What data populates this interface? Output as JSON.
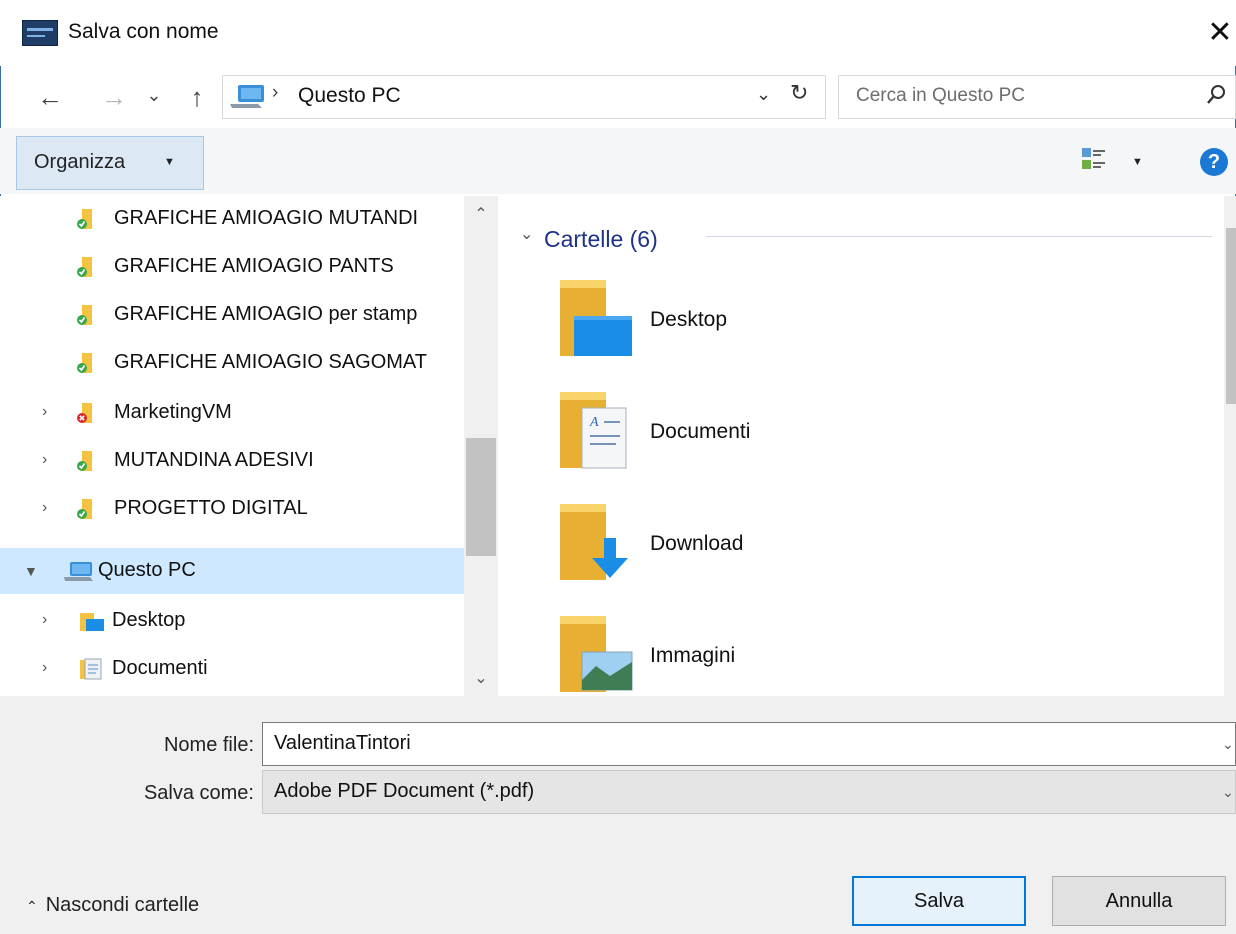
{
  "window": {
    "title": "Salva con nome",
    "close_symbol": "✕"
  },
  "nav": {
    "back_symbol": "←",
    "forward_symbol": "→",
    "recent_symbol": "⌄",
    "up_symbol": "↑",
    "separator": "›",
    "address_text": "Questo PC",
    "dropdown_symbol": "⌄",
    "refresh_symbol": "↻",
    "search_placeholder": "Cerca in Questo PC"
  },
  "toolbar": {
    "organize_label": "Organizza",
    "help_symbol": "?"
  },
  "tree": [
    {
      "label": "GRAFICHE AMIOAGIO MUTANDI",
      "icon": "folder-synced-icon",
      "expandable": false
    },
    {
      "label": "GRAFICHE AMIOAGIO PANTS",
      "icon": "folder-synced-icon",
      "expandable": false
    },
    {
      "label": "GRAFICHE AMIOAGIO per stamp",
      "icon": "folder-synced-icon",
      "expandable": false
    },
    {
      "label": "GRAFICHE AMIOAGIO SAGOMAT",
      "icon": "folder-synced-icon",
      "expandable": false
    },
    {
      "label": "MarketingVM",
      "icon": "folder-error-icon",
      "expandable": true
    },
    {
      "label": "MUTANDINA ADESIVI",
      "icon": "folder-synced-icon",
      "expandable": true
    },
    {
      "label": "PROGETTO DIGITAL",
      "icon": "folder-synced-icon",
      "expandable": true
    },
    {
      "label": "Questo PC",
      "icon": "computer-icon",
      "expandable": true,
      "expanded": true,
      "selected": true
    },
    {
      "label": "Desktop",
      "icon": "desktop-folder-icon",
      "expandable": true
    },
    {
      "label": "Documenti",
      "icon": "documents-folder-icon",
      "expandable": true
    }
  ],
  "content": {
    "group_title": "Cartelle (6)",
    "items": [
      {
        "label": "Desktop",
        "icon": "desktop-folder-icon"
      },
      {
        "label": "Documenti",
        "icon": "documents-folder-icon"
      },
      {
        "label": "Download",
        "icon": "downloads-folder-icon"
      },
      {
        "label": "Immagini",
        "icon": "pictures-folder-icon"
      }
    ]
  },
  "form": {
    "filename_label": "Nome file:",
    "filename_value": "ValentinaTintori",
    "savetype_label": "Salva come:",
    "savetype_value": "Adobe PDF Document (*.pdf)",
    "hide_folders_label": "Nascondi cartelle",
    "save_label": "Salva",
    "cancel_label": "Annulla"
  },
  "colors": {
    "accent": "#0078d7",
    "selection": "#cde8ff",
    "group_title": "#1e3287",
    "folder": "#f5c342",
    "sync_ok": "#3aa64a",
    "sync_error": "#d9262b"
  }
}
